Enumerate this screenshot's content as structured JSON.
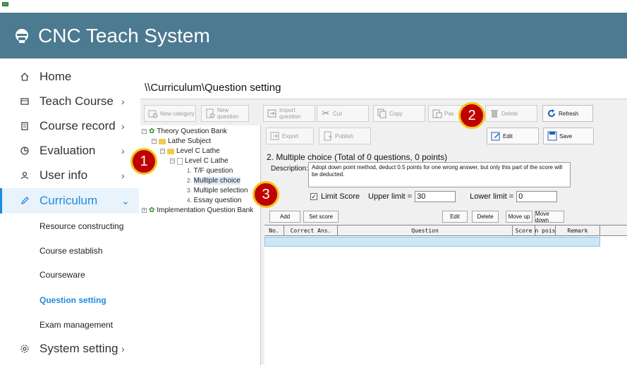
{
  "app": {
    "title": "CNC Teach System"
  },
  "sidebar": {
    "items": [
      {
        "label": "Home",
        "icon": "home-icon",
        "chevron": ""
      },
      {
        "label": "Teach Course",
        "icon": "course-icon",
        "chevron": "›"
      },
      {
        "label": "Course record",
        "icon": "record-icon",
        "chevron": "›"
      },
      {
        "label": "Evaluation",
        "icon": "evaluation-icon",
        "chevron": "›"
      },
      {
        "label": "User info",
        "icon": "user-icon",
        "chevron": "›"
      },
      {
        "label": "Curriculum",
        "icon": "pencil-icon",
        "chevron": "⌄"
      },
      {
        "label": "System setting",
        "icon": "gear-icon",
        "chevron": "›"
      }
    ],
    "sub_items": [
      "Resource constructing",
      "Course establish",
      "Courseware",
      "Question setting",
      "Exam management"
    ]
  },
  "breadcrumb": "\\\\Curriculum\\Question setting",
  "toolbar": {
    "new_category": "New category",
    "new_question": "New question",
    "import_question": "Import question",
    "cut": "Cut",
    "copy": "Copy",
    "paste": "Pas",
    "delete": "Delete",
    "refresh": "Refresh",
    "export": "Export",
    "publish": "Publish",
    "edit": "Edit",
    "save": "Save"
  },
  "tree": {
    "root1": "Theory Question Bank",
    "lathe_subject": "Lathe Subject",
    "level_c_lathe": "Level C Lathe",
    "level_c_lathe_child": "Level C Lathe",
    "leaves": [
      {
        "num": "1.",
        "label": "T/F question"
      },
      {
        "num": "2.",
        "label": "Multiple choice"
      },
      {
        "num": "3.",
        "label": "Multiple selection"
      },
      {
        "num": "4.",
        "label": "Essay question"
      }
    ],
    "root2": "Implementation Question Bank"
  },
  "question": {
    "title": "2. Multiple choice (Total of 0 questions, 0 points)",
    "description_label": "Description:",
    "description": "Adopt down point method, deduct 0.5 points for one wrong answer, but only this part of the score will be deducted.",
    "limit_score_label": "Limit Score",
    "limit_checked": "✓",
    "upper_label": "Upper limit =",
    "upper_value": "30",
    "lower_label": "Lower limit =",
    "lower_value": "0"
  },
  "actions": {
    "add": "Add",
    "set_score": "Set score",
    "edit": "Edit",
    "delete": "Delete",
    "move_up": "Move up",
    "move_down": "Move down"
  },
  "grid": {
    "columns": [
      "No.",
      "Correct Ans.",
      "Question",
      "Score",
      "n pois",
      "Remark"
    ]
  },
  "badges": {
    "one": "1",
    "two": "2",
    "three": "3"
  },
  "colors": {
    "header": "#4b7a91",
    "accent": "#1f8ae0",
    "badge": "#c00000",
    "badge_border": "#f0c419"
  }
}
